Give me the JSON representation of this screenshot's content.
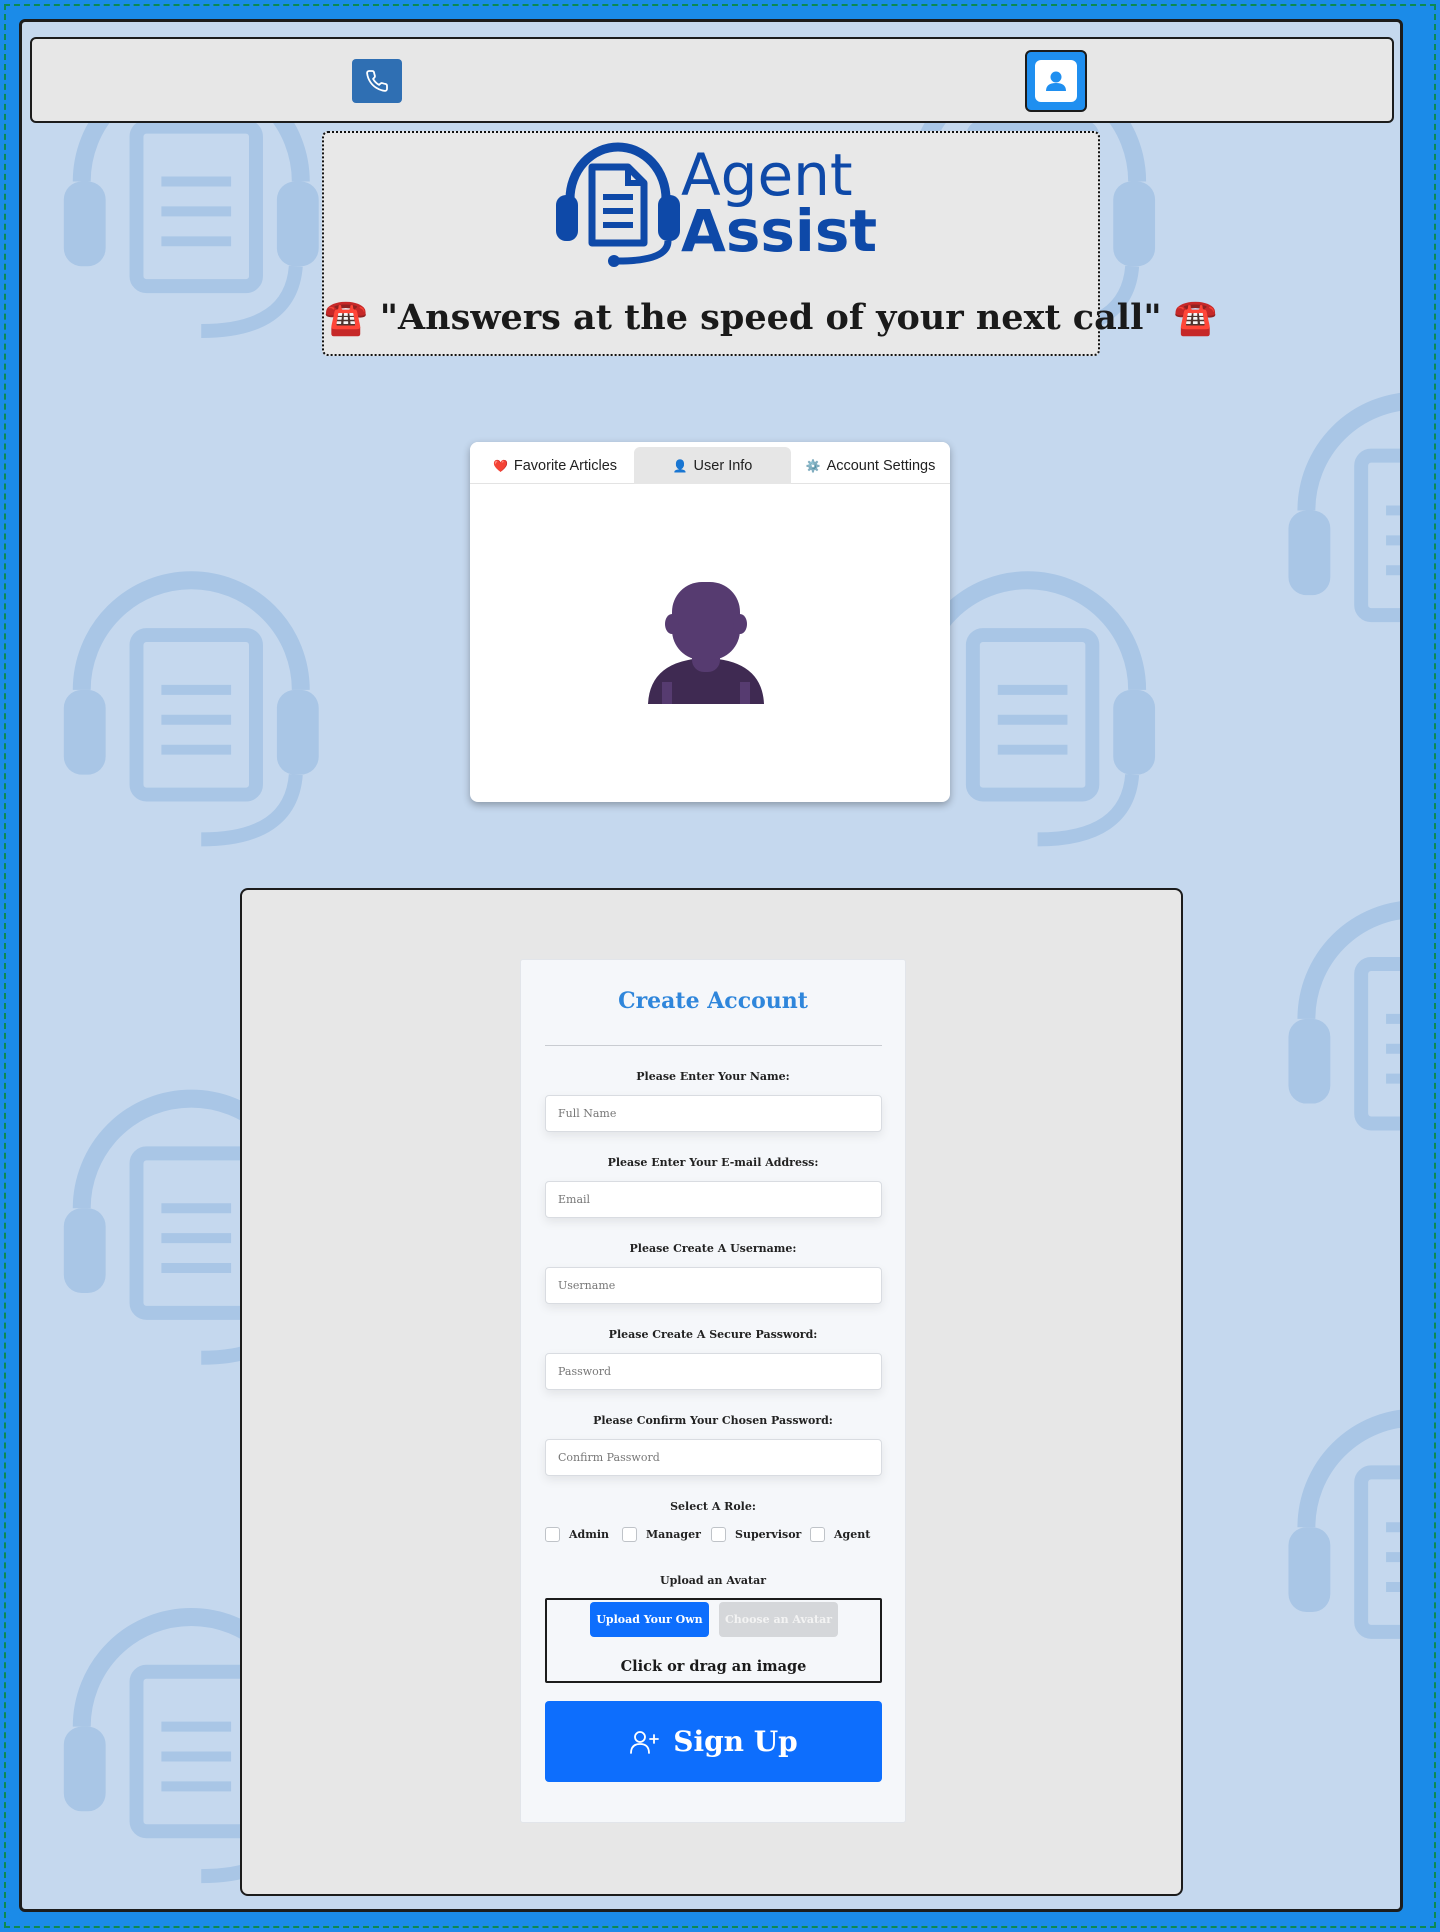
{
  "colors": {
    "page_border": "#1b8be8",
    "brand": "#0e49a8",
    "primary": "#0d6efd",
    "title_accent": "#2f86db",
    "nav_phone": "#2f6fb3",
    "avatar": "#4b3560"
  },
  "nav": {
    "phone_icon": "phone-icon",
    "profile_icon": "user-profile-icon"
  },
  "hero": {
    "logo_line1": "Agent",
    "logo_line2": "Assist",
    "slogan_icon": "☎️",
    "slogan": "\"Answers at the speed of your next call\""
  },
  "tabs": [
    {
      "icon": "❤️",
      "label": "Favorite Articles"
    },
    {
      "icon": "👤",
      "label": "User Info"
    },
    {
      "icon": "⚙️",
      "label": "Account Settings"
    }
  ],
  "form": {
    "title": "Create Account",
    "name_label": "Please Enter Your Name:",
    "name_placeholder": "Full Name",
    "email_label": "Please Enter Your E-mail Address:",
    "email_placeholder": "Email",
    "username_label": "Please Create A Username:",
    "username_placeholder": "Username",
    "password_label": "Please Create A Secure Password:",
    "password_placeholder": "Password",
    "confirm_label": "Please Confirm Your Chosen Password:",
    "confirm_placeholder": "Confirm Password",
    "role_label": "Select A Role:",
    "roles": [
      "Admin",
      "Manager",
      "Supervisor",
      "Agent"
    ],
    "avatar_label": "Upload an Avatar",
    "upload_own": "Upload Your Own",
    "choose_avatar": "Choose an Avatar",
    "drag_text": "Click or drag an image",
    "signup": "Sign Up"
  }
}
